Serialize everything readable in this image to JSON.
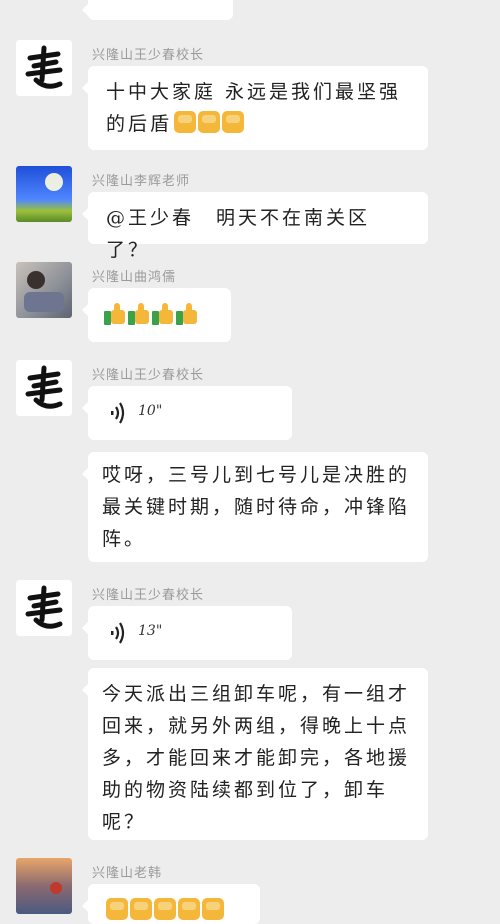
{
  "messages": [
    {
      "sender": "兴隆山王少春校长",
      "text": "十中大家庭 永远是我们最坚强的后盾"
    },
    {
      "sender": "兴隆山李辉老师",
      "text": "@王少春　明天不在南关区了？"
    },
    {
      "sender": "兴隆山曲鸿儒"
    },
    {
      "sender": "兴隆山王少春校长",
      "voice": "10\"",
      "text": "哎呀，三号儿到七号儿是决胜的最关键时期，随时待命，冲锋陷阵。"
    },
    {
      "sender": "兴隆山王少春校长",
      "voice": "13\"",
      "text": "今天派出三组卸车呢，有一组才回来，就另外两组，得晚上十点多，才能回来才能卸完，各地援助的物资陆续都到位了，卸车呢？"
    },
    {
      "sender": "兴隆山老韩"
    }
  ]
}
